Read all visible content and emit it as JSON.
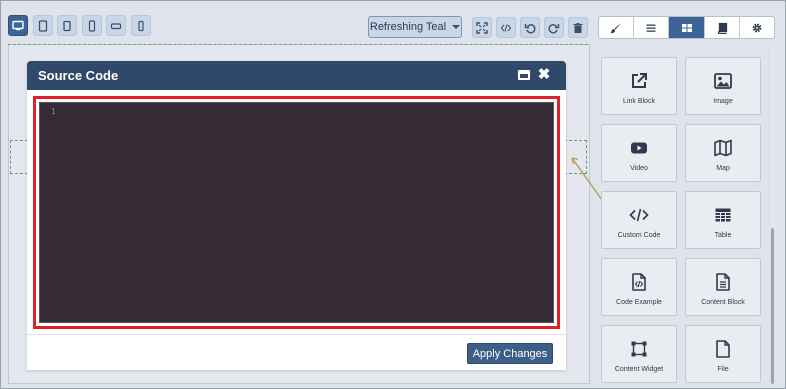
{
  "toolbar": {
    "devices": [
      {
        "name": "desktop",
        "active": true
      },
      {
        "name": "tablet",
        "active": false
      },
      {
        "name": "tablet-small",
        "active": false
      },
      {
        "name": "mobile",
        "active": false
      },
      {
        "name": "mobile-landscape",
        "active": false
      },
      {
        "name": "mobile-portrait",
        "active": false
      }
    ],
    "theme_label": "Refreshing Teal",
    "actions": [
      "fullscreen-icon",
      "code-icon",
      "undo-icon",
      "redo-icon",
      "trash-icon"
    ]
  },
  "panel_tabs": [
    {
      "icon": "brush-icon",
      "active": false
    },
    {
      "icon": "menu-icon",
      "active": false
    },
    {
      "icon": "blocks-icon",
      "active": true
    },
    {
      "icon": "book-icon",
      "active": false
    },
    {
      "icon": "gear-icon",
      "active": false
    }
  ],
  "modal": {
    "title": "Source Code",
    "line_number": "1",
    "apply_label": "Apply Changes",
    "highlight_color": "#e01f26"
  },
  "blocks": [
    {
      "label": "Link Block",
      "icon": "external-link-icon"
    },
    {
      "label": "Image",
      "icon": "image-icon"
    },
    {
      "label": "Video",
      "icon": "video-icon"
    },
    {
      "label": "Map",
      "icon": "map-icon"
    },
    {
      "label": "Custom Code",
      "icon": "code-icon"
    },
    {
      "label": "Table",
      "icon": "table-icon"
    },
    {
      "label": "Code Example",
      "icon": "code-file-icon"
    },
    {
      "label": "Content Block",
      "icon": "document-icon"
    },
    {
      "label": "Content Widget",
      "icon": "widget-icon"
    },
    {
      "label": "File",
      "icon": "file-icon"
    }
  ],
  "colors": {
    "accent": "#3d6496",
    "modal_header": "#30496b",
    "editor_bg": "#352b35"
  }
}
